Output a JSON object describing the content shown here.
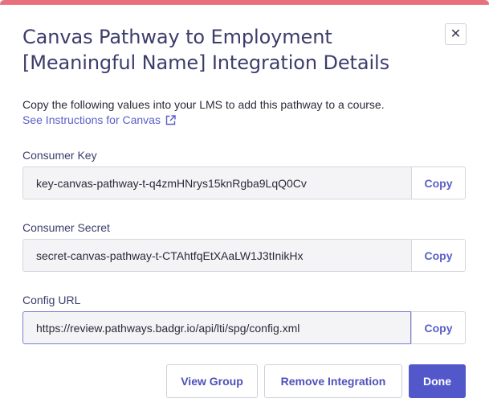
{
  "modal": {
    "title": "Canvas Pathway to Employment [Meaningful Name] Integration Details",
    "close_glyph": "✕",
    "intro": "Copy the following values into your LMS to add this pathway to a course.",
    "instructions_link": "See Instructions for Canvas"
  },
  "fields": {
    "consumer_key": {
      "label": "Consumer Key",
      "value": "key-canvas-pathway-t-q4zmHNrys15knRgba9LqQ0Cv",
      "copy_label": "Copy"
    },
    "consumer_secret": {
      "label": "Consumer Secret",
      "value": "secret-canvas-pathway-t-CTAhtfqEtXAaLW1J3tInikHx",
      "copy_label": "Copy"
    },
    "config_url": {
      "label": "Config URL",
      "value": "https://review.pathways.badgr.io/api/lti/spg/config.xml",
      "copy_label": "Copy"
    }
  },
  "footer": {
    "view_group": "View Group",
    "remove_integration": "Remove Integration",
    "done": "Done"
  },
  "colors": {
    "accent": "#5257c9",
    "top_border": "#e8707d",
    "title": "#3c3d6b"
  }
}
